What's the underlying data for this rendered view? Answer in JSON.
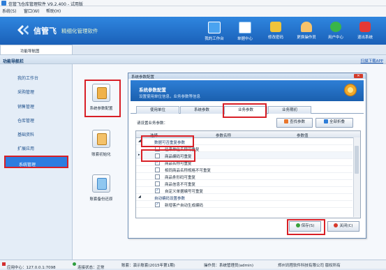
{
  "window": {
    "title": "信管飞仓库管理软件 V9.2.400 - 试用版"
  },
  "menu": [
    "系统(S)",
    "窗口(W)",
    "帮助(H)"
  ],
  "brand": {
    "logo": "信管飞",
    "slogan": "精细化管理软件"
  },
  "toolbar": [
    {
      "label": "我的工作台",
      "icon": "monitor-icon",
      "color": "#4aa3f0"
    },
    {
      "label": "单据中心",
      "icon": "document-list-icon",
      "color": "#7fb9ee"
    },
    {
      "label": "修改密码",
      "icon": "lock-icon",
      "color": "#f0c43a"
    },
    {
      "label": "更换操作员",
      "icon": "user-icon",
      "color": "#f7c36b"
    },
    {
      "label": "用户中心",
      "icon": "globe-icon",
      "color": "#39b54a"
    },
    {
      "label": "退出系统",
      "icon": "power-icon",
      "color": "#e53935"
    }
  ],
  "nav": {
    "tab": "功能导航图",
    "header": "功能导航栏",
    "download_link": "扫描下载APP",
    "items": [
      "我的工作台",
      "采购管理",
      "销售管理",
      "仓库管理",
      "基础资料",
      "扩展应用",
      "系统管理"
    ],
    "active": "系统管理"
  },
  "features": [
    {
      "label": "系统参数配置"
    },
    {
      "label": "账套初始化"
    },
    {
      "label": "账套备份还原"
    }
  ],
  "dialog": {
    "title": "系统参数配置",
    "close": "✕",
    "heading": "系统参数配置",
    "subheading": "设置使用单位信息，业务参数等信息",
    "tabs": [
      "使用单位",
      "系统参数",
      "业务参数",
      "业务期初"
    ],
    "active_tab": "业务参数",
    "prompt": "请设置业务参数：",
    "find_button": "查找参数",
    "collapse_button": "全部折叠",
    "columns": [
      "选择",
      "参数名称",
      "参数值"
    ],
    "rows": [
      {
        "type": "group",
        "name": "数据可否重复参数",
        "indicator": "◢"
      },
      {
        "type": "item",
        "name": "往来单位名称可重复",
        "checked": false,
        "indicator": ""
      },
      {
        "type": "item",
        "name": "商品编码可重复",
        "checked": false,
        "indicator": "▸"
      },
      {
        "type": "item",
        "name": "商品名称可重复",
        "checked": true,
        "indicator": ""
      },
      {
        "type": "item",
        "name": "相同商品名称规格不可重复",
        "checked": false,
        "indicator": ""
      },
      {
        "type": "item",
        "name": "商品条形码可重复",
        "checked": false,
        "indicator": ""
      },
      {
        "type": "item",
        "name": "商品信息不可重复",
        "checked": false,
        "indicator": ""
      },
      {
        "type": "item",
        "name": "自定义单据编号可重复",
        "checked": true,
        "indicator": ""
      },
      {
        "type": "group",
        "name": "自动编码设置参数",
        "indicator": "◢"
      },
      {
        "type": "item",
        "name": "新增客户自动生成编码",
        "checked": true,
        "indicator": ""
      }
    ],
    "save_button": "保存(S)",
    "close_button": "关闭(C)"
  },
  "statusbar": {
    "app_center": "应用中心：127.0.0.1:7098",
    "connection": "连接状态：正常",
    "account": "账套：演示账套(2015年第1期)",
    "operator": "操作员：系统管理员(admin)",
    "company": "郑州讯程软件科技有限公司 版权所有"
  }
}
